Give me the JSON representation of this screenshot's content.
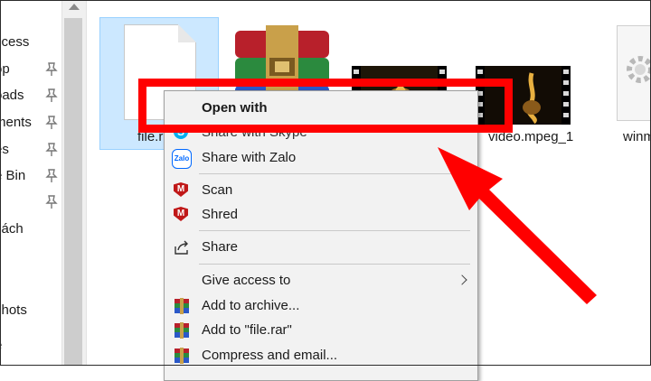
{
  "sidebar": {
    "items": [
      {
        "label": "ccess",
        "pinned": false
      },
      {
        "label": "op",
        "pinned": true
      },
      {
        "label": "oads",
        "pinned": true
      },
      {
        "label": "ments",
        "pinned": true
      },
      {
        "label": "es",
        "pinned": true
      },
      {
        "label": "e Bin",
        "pinned": true
      },
      {
        "label": "",
        "pinned": true
      },
      {
        "label": "sách",
        "pinned": false
      },
      {
        "label": "shots",
        "pinned": false
      },
      {
        "label": "e",
        "pinned": false
      }
    ]
  },
  "files": [
    {
      "name": "file.r",
      "icon": "document-icon",
      "selected": true
    },
    {
      "name": "",
      "icon": "winrar-icon"
    },
    {
      "name": "",
      "icon": "video-thumbnail-icon"
    },
    {
      "name": "video.mpeg_1",
      "icon": "video-thumbnail-icon"
    },
    {
      "name": "winm",
      "icon": "gear-icon"
    }
  ],
  "context_menu": {
    "open_with": "Open with",
    "share_skype": "Share with Skype",
    "share_zalo": "Share with Zalo",
    "zalo_badge": "Zalo",
    "scan": "Scan",
    "shred": "Shred",
    "share": "Share",
    "give_access": "Give access to",
    "add_archive": "Add to archive...",
    "add_rar": "Add to \"file.rar\"",
    "compress_email": "Compress and email..."
  },
  "colors": {
    "highlight": "#ff0000",
    "selection": "#cce8ff",
    "menu_bg": "#f2f2f2"
  }
}
